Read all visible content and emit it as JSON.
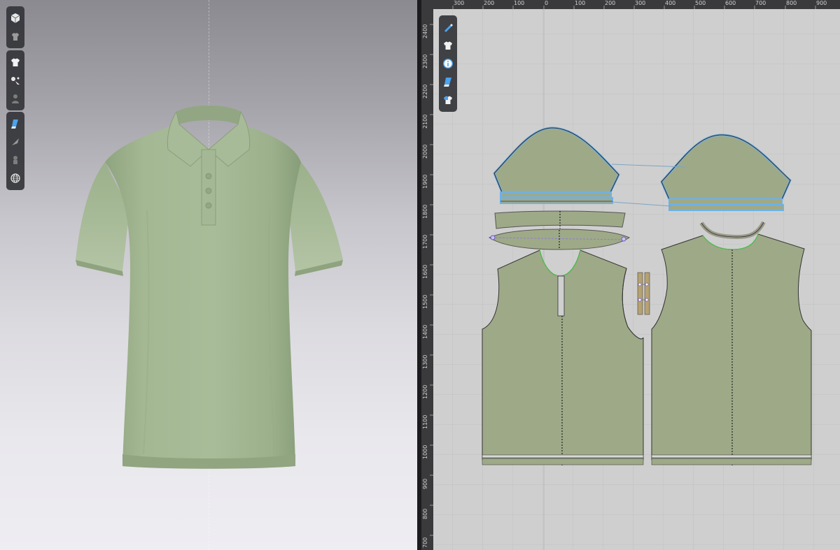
{
  "viewport_3d": {
    "background_top": "#8c8a91",
    "background_bottom": "#eeedf2",
    "garment_color": "#9fb48f",
    "garment_type": "polo-shirt",
    "toolbar_groups": [
      [
        "cube-view-icon",
        "avatar-display-icon"
      ],
      [
        "garment-display-icon",
        "simulation-properties-icon",
        "avatar-silhouette-icon"
      ],
      [
        "texture-display-icon",
        "fabric-pin-icon",
        "hanger-icon",
        "globe-icon"
      ]
    ]
  },
  "viewport_2d": {
    "background": "#cfcfcf",
    "pattern_fill": "#9ea988",
    "selection_color": "#6fb1e6",
    "top_ruler_labels": [
      "300",
      "200",
      "100",
      "0",
      "100",
      "200",
      "300",
      "400",
      "500",
      "600",
      "700",
      "800",
      "900"
    ],
    "left_ruler_labels": [
      "2400",
      "2300",
      "2200",
      "2100",
      "2000",
      "1900",
      "1800",
      "1700",
      "1600",
      "1500",
      "1400",
      "1300",
      "1200",
      "1100",
      "1000",
      "900",
      "800",
      "700"
    ],
    "toolbar": [
      "edit-pattern-icon",
      "garment-icon",
      "info-icon",
      "texture-icon",
      "shirt-color-icon"
    ],
    "pieces": [
      "sleeve-left",
      "sleeve-cuff-left",
      "sleeve-right",
      "sleeve-cuff-right",
      "collar",
      "collar-stand",
      "front-body",
      "placket",
      "back-body",
      "back-neck-binding"
    ]
  }
}
